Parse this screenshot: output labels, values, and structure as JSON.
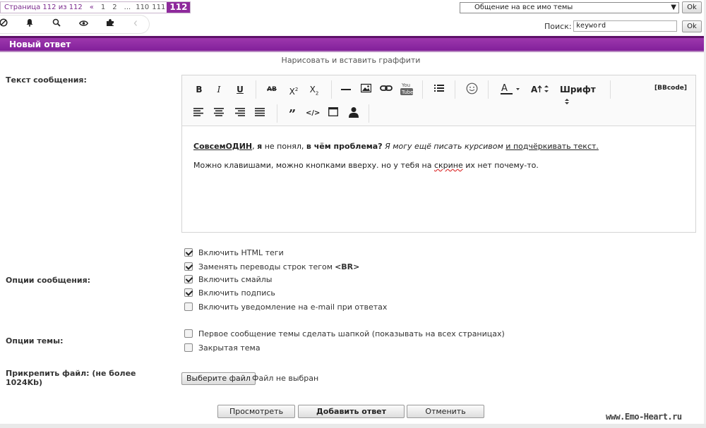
{
  "pagination": {
    "info": "Страница 112 из 112",
    "prev": "«",
    "pages": [
      "1",
      "2"
    ],
    "ellipsis": "...",
    "tail_pages": [
      "110",
      "111"
    ],
    "current": "112"
  },
  "topic_select": {
    "selected": "Общение на все имо темы",
    "arrow": "▼"
  },
  "ok_label": "Ok",
  "icon_bar": [
    "no-icon",
    "bell-icon",
    "search-icon",
    "eye-icon",
    "puzzle-icon",
    "chevron-left-icon"
  ],
  "search": {
    "label": "Поиск:",
    "value": "keyword"
  },
  "header": {
    "title": "Новый ответ"
  },
  "graffiti_link": "Нарисовать и вставить граффити",
  "labels": {
    "message_text": "Текст сообщения:",
    "message_options": "Опции сообщения:",
    "topic_options": "Опции темы:",
    "attach_line1": "Прикрепить файл: (не более",
    "attach_line2": "1024Kb)"
  },
  "editor": {
    "bbcode": "[BBcode]",
    "font_label": "Шрифт",
    "message": {
      "p1_bold1": "СовсемОДИН",
      "p1_t1": ", ",
      "p1_bold2": "я",
      "p1_t2": " не понял, ",
      "p1_bold3": "в чём проблема?",
      "p1_t3": " ",
      "p1_italic": "Я могу ещё писать курсивом",
      "p1_t4": " ",
      "p1_under": "и подчёркивать текст.",
      "p2_a": "Можно клавишами, можно кнопками вверху. но у тебя на ",
      "p2_squig": "скрине",
      "p2_b": " их нет почему-то."
    }
  },
  "message_options": [
    {
      "label": "Включить HTML теги",
      "checked": true
    },
    {
      "label": "Заменять переводы строк тегом ",
      "bold_suffix": "<BR>",
      "checked": true
    },
    {
      "label": "Включить смайлы",
      "checked": true
    },
    {
      "label": "Включить подпись",
      "checked": true
    },
    {
      "label": "Включить уведомление на e-mail при ответах",
      "checked": false
    }
  ],
  "topic_options": [
    {
      "label": "Первое сообщение темы сделать шапкой (показывать на всех страницах)",
      "checked": false
    },
    {
      "label": "Закрытая тема",
      "checked": false
    }
  ],
  "file": {
    "button": "Выберите файл",
    "status": "Файл не выбран"
  },
  "buttons": {
    "preview": "Просмотреть",
    "submit": "Добавить ответ",
    "cancel": "Отменить"
  },
  "watermark": "www.Emo-Heart.ru"
}
